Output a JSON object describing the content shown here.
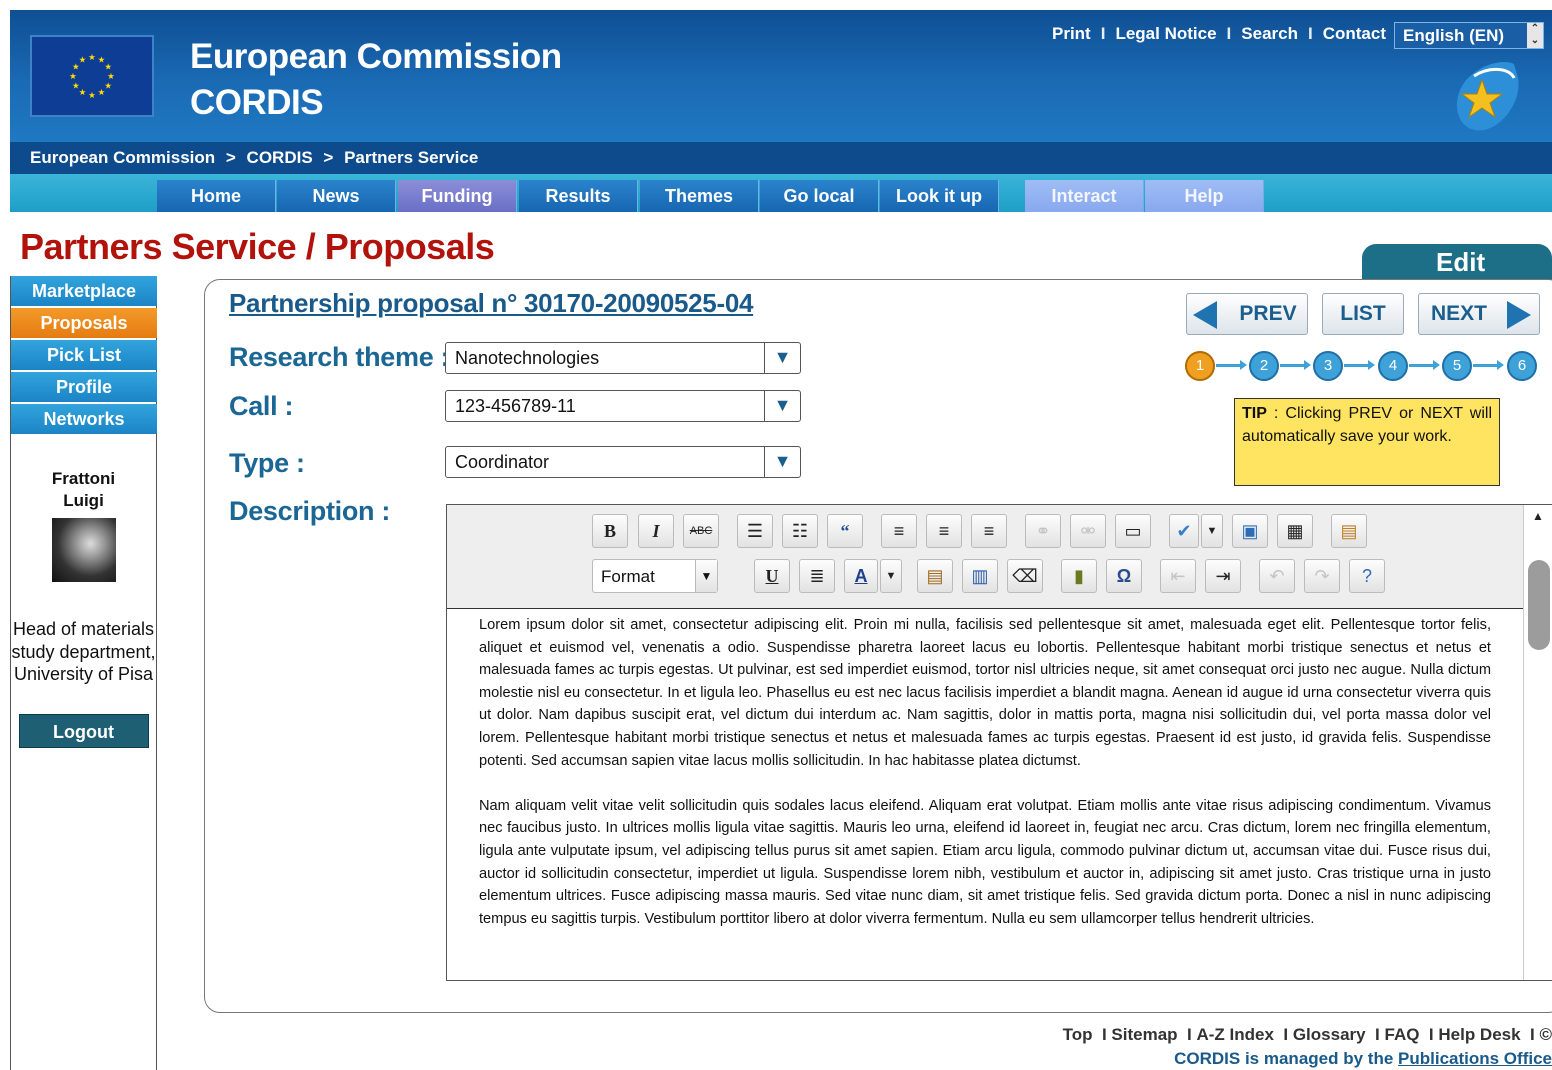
{
  "header": {
    "brand_line1": "European Commission",
    "brand_line2": "CORDIS",
    "top_links": [
      "Print",
      "Legal Notice",
      "Search",
      "Contact"
    ],
    "language": "English (EN)"
  },
  "breadcrumb": [
    "European Commission",
    ">",
    "CORDIS",
    ">",
    "Partners Service"
  ],
  "nav": [
    {
      "label": "Home"
    },
    {
      "label": "News"
    },
    {
      "label": "Funding"
    },
    {
      "label": "Results"
    },
    {
      "label": "Themes"
    },
    {
      "label": "Go local"
    },
    {
      "label": "Look it up"
    },
    {
      "label": "Interact"
    },
    {
      "label": "Help"
    }
  ],
  "page_title": "Partners Service / Proposals",
  "sidebar": {
    "items": [
      "Marketplace",
      "Proposals",
      "Pick List",
      "Profile",
      "Networks"
    ],
    "active": "Proposals",
    "user_first": "Frattoni",
    "user_last": "Luigi",
    "user_role": "Head of materials study department, University of Pisa",
    "logout": "Logout"
  },
  "edit_tab": "Edit",
  "proposal": {
    "title": "Partnership proposal n° 30170-20090525-04",
    "research_theme_label": "Research theme :",
    "research_theme_value": "Nanotechnologies",
    "call_label": "Call :",
    "call_value": "123-456789-11",
    "type_label": "Type :",
    "type_value": "Coordinator",
    "description_label": "Description :"
  },
  "pager": {
    "prev": "PREV",
    "list": "LIST",
    "next": "NEXT"
  },
  "steps": [
    "1",
    "2",
    "3",
    "4",
    "5",
    "6"
  ],
  "current_step": "1",
  "tip": {
    "label": "TIP",
    "text": " : Clicking PREV or NEXT will automatically save your work."
  },
  "editor": {
    "format_label": "Format",
    "paragraphs": [
      "Lorem ipsum dolor sit amet, consectetur adipiscing elit. Proin mi nulla, facilisis sed pellentesque sit amet, malesuada eget elit. Pellentesque tortor felis, aliquet et euismod vel, venenatis a odio. Suspendisse pharetra laoreet lacus eu lobortis. Pellentesque habitant morbi tristique senectus et netus et malesuada fames ac turpis egestas. Ut pulvinar, est sed imperdiet euismod, tortor nisl ultricies neque, sit amet consequat orci justo nec augue. Nulla dictum molestie nisl eu consectetur. In et ligula leo. Phasellus eu est nec lacus facilisis imperdiet a blandit magna. Aenean id augue id urna consectetur viverra quis ut dolor. Nam dapibus suscipit erat, vel dictum dui interdum ac. Nam sagittis, dolor in mattis porta, magna nisi sollicitudin dui, vel porta massa dolor vel lorem. Pellentesque habitant morbi tristique senectus et netus et malesuada fames ac turpis egestas. Praesent id est justo, id gravida felis. Suspendisse potenti. Sed accumsan sapien vitae lacus mollis sollicitudin. In hac habitasse platea dictumst.",
      "Nam aliquam velit vitae velit sollicitudin quis sodales lacus eleifend. Aliquam erat volutpat. Etiam mollis ante vitae risus adipiscing condimentum. Vivamus nec faucibus justo. In ultrices mollis ligula vitae sagittis. Mauris leo urna, eleifend id laoreet in, feugiat nec arcu. Cras dictum, lorem nec fringilla elementum, ligula ante vulputate ipsum, vel adipiscing tellus purus sit amet sapien. Etiam arcu ligula, commodo pulvinar dictum ut, accumsan vitae dui. Fusce risus dui, auctor id sollicitudin consectetur, imperdiet ut ligula. Suspendisse lorem nibh, vestibulum et auctor in, adipiscing sit amet justo. Cras tristique urna in justo elementum ultrices. Fusce adipiscing massa mauris. Sed vitae nunc diam, sit amet tristique felis. Sed gravida dictum porta. Donec a nisl in nunc adipiscing tempus eu sagittis turpis. Vestibulum porttitor libero at dolor viverra fermentum. Nulla eu sem ullamcorper tellus hendrerit ultricies."
    ]
  },
  "footer": {
    "links": [
      "Top",
      "Sitemap",
      "A-Z Index",
      "Glossary",
      "FAQ",
      "Help Desk",
      "©"
    ],
    "managed_prefix": "CORDIS is managed by the ",
    "managed_link": "Publications Office"
  },
  "colors": {
    "title_red": "#b2120c",
    "label_blue": "#1a6695",
    "nav_active": "#7a7fcf",
    "sidebar_active": "#ec8a1c",
    "tip_yellow": "#ffe461"
  }
}
